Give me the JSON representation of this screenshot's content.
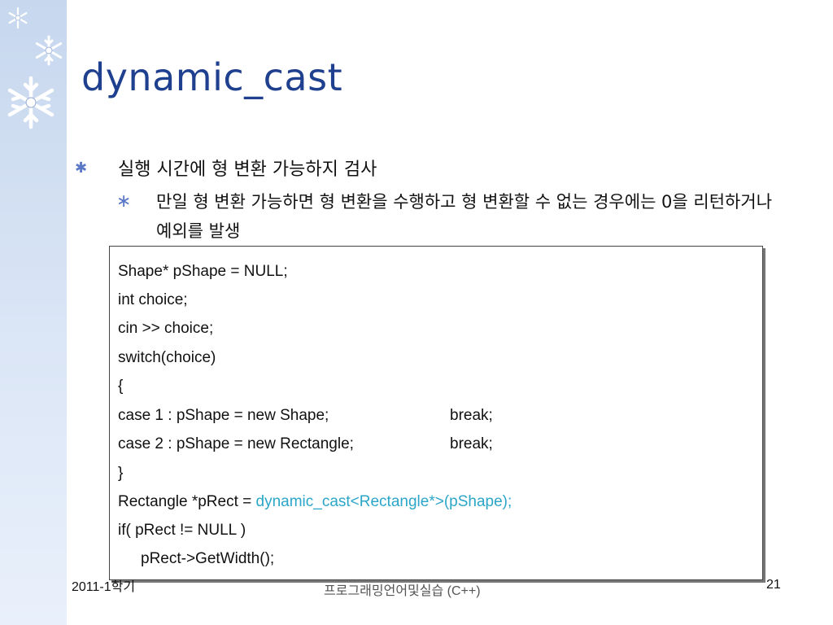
{
  "title": "dynamic_cast",
  "bullets": {
    "level1": "실행 시간에 형 변환 가능하지 검사",
    "level2": "만일 형 변환 가능하면 형 변환을 수행하고 형 변환할 수 없는 경우에는 0을 리턴하거나 예외를 발생"
  },
  "code": {
    "line1": "Shape* pShape = NULL;",
    "line2": "int choice;",
    "line3": "cin >> choice;",
    "line4": "switch(choice)",
    "line5": "{",
    "line6a": "case 1 : pShape = new Shape;",
    "line6b": "break;",
    "line7a": "case 2 : pShape = new Rectangle;",
    "line7b": "break;",
    "line8": "}",
    "line9a": "Rectangle *pRect = ",
    "line9b": "dynamic_cast<Rectangle*>(pShape);",
    "line10": "if( pRect != NULL )",
    "line11": "pRect->GetWidth();"
  },
  "footer": {
    "left": "2011-1학기",
    "center": "프로그래밍언어및실습 (C++)",
    "page": "21"
  },
  "colors": {
    "title": "#1f3f8f",
    "highlight": "#2ba6c8",
    "sidebar": "#d4e1f4"
  }
}
